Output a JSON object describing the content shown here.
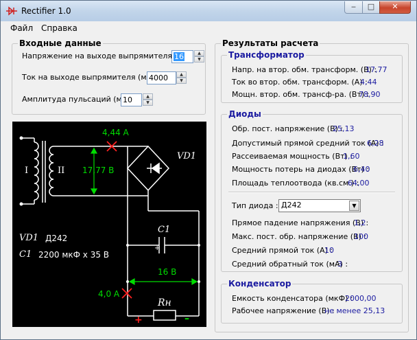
{
  "window": {
    "title": "Rectifier 1.0",
    "minimize": "‒",
    "maximize": "□",
    "close": "✕"
  },
  "menu": {
    "file": "Файл",
    "help": "Справка"
  },
  "inputs": {
    "title": "Входные данные",
    "voltage_label": "Напряжение на выходе выпрямителя (В) :",
    "voltage_value": "16",
    "current_label": "Ток на выходе выпрямителя (мА) :",
    "current_value": "4000",
    "ripple_label": "Амплитуда пульсаций (мВ) :",
    "ripple_value": "10"
  },
  "diagram": {
    "current_top": "4,44 A",
    "voltage_secondary": "17,77 В",
    "winding1": "I",
    "winding2": "II",
    "vd1_ref": "VD1",
    "cap_ref": "C1",
    "vd1_legend_ref": "VD1",
    "vd1_legend_value": "Д242",
    "c1_legend_ref": "C1",
    "c1_legend_value": "2200 мкФ х 35 В",
    "plus_small": "+",
    "output_voltage": "16 В",
    "output_current": "4,0 A",
    "load_ref": "Rн",
    "plus": "+",
    "minus": "–",
    "colors": {
      "wire": "#ffffff",
      "measure": "#00dd00",
      "cross": "#ff2020",
      "plus": "#ff2020",
      "minus": "#00dd00"
    }
  },
  "results": {
    "title": "Результаты расчета",
    "transformer": {
      "title": "Трансформатор",
      "rows": [
        {
          "label": "Напр. на втор. обм. трансформ. (В) :",
          "value": "17,77"
        },
        {
          "label": "Ток во втор. обм. трансформ. (А) :",
          "value": "4,44"
        },
        {
          "label": "Мощн. втор. обм. трансф-ра. (Вт) :",
          "value": "78,90"
        }
      ]
    },
    "diodes": {
      "title": "Диоды",
      "rows": [
        {
          "label": "Обр. пост. напряжение (В) :",
          "value": "25,13"
        },
        {
          "label": "Допустимый прямой средний ток (А) :",
          "value": "6,28"
        },
        {
          "label": "Рассеиваемая мощность (Вт) :",
          "value": "1,60"
        },
        {
          "label": "Мощность потерь на диодах (Вт) :",
          "value": "6,40"
        },
        {
          "label": "Площадь теплоотвода (кв.см.) :",
          "value": "64,00"
        }
      ],
      "type_label": "Тип диода :",
      "type_value": "Д242",
      "params": [
        {
          "label": "Прямое падение напряжения (В) :",
          "value": "1,2"
        },
        {
          "label": "Макс. пост. обр. напряжение (В) :",
          "value": "100"
        },
        {
          "label": "Средний прямой ток (А) :",
          "value": "10"
        },
        {
          "label": "Средний обратный ток (мА) :",
          "value": "3"
        }
      ]
    },
    "capacitor": {
      "title": "Конденсатор",
      "rows": [
        {
          "label": "Емкость конденсатора (мкФ) :",
          "value": "2000,00"
        },
        {
          "label": "Рабочее напряжение (В) :",
          "value": "не менее 25,13"
        }
      ]
    }
  }
}
